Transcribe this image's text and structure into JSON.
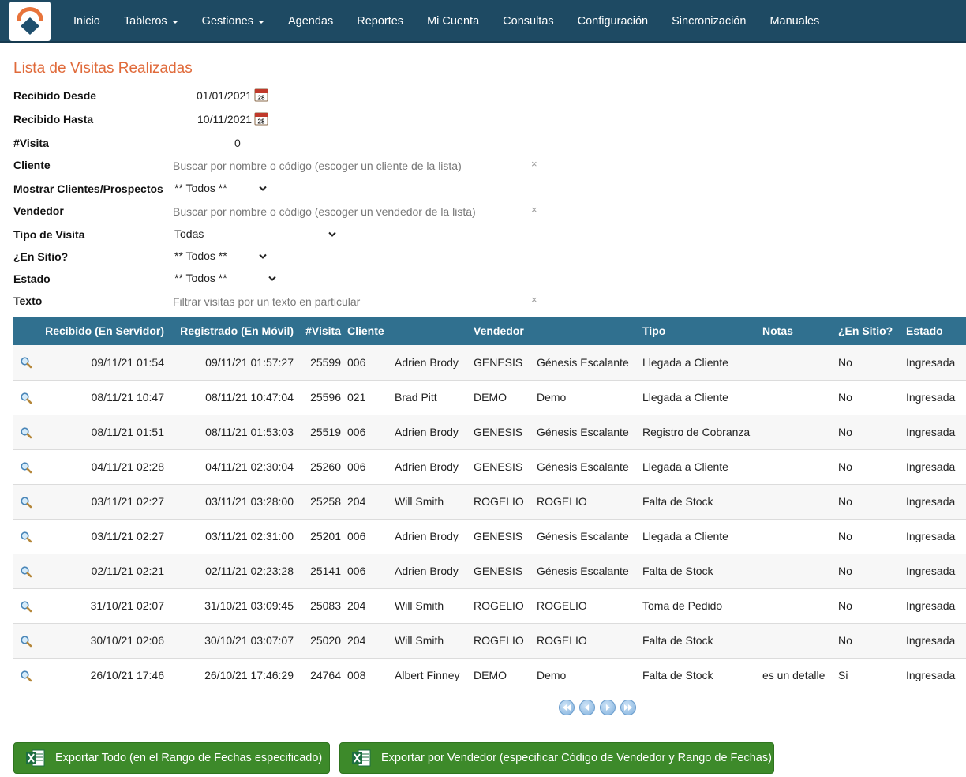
{
  "nav": {
    "items": [
      "Inicio",
      "Tableros",
      "Gestiones",
      "Agendas",
      "Reportes",
      "Mi Cuenta",
      "Consultas",
      "Configuración",
      "Sincronización",
      "Manuales"
    ]
  },
  "page": {
    "title": "Lista de Visitas Realizadas"
  },
  "filters": {
    "recibido_desde": {
      "label": "Recibido Desde",
      "value": "01/01/2021"
    },
    "recibido_hasta": {
      "label": "Recibido Hasta",
      "value": "10/11/2021"
    },
    "visita": {
      "label": "#Visita",
      "value": "0"
    },
    "cliente": {
      "label": "Cliente",
      "placeholder": "Buscar por nombre o código (escoger un cliente de la lista)"
    },
    "mostrar": {
      "label": "Mostrar Clientes/Prospectos",
      "value": "** Todos **"
    },
    "vendedor": {
      "label": "Vendedor",
      "placeholder": "Buscar por nombre o código (escoger un vendedor de la lista)"
    },
    "tipo": {
      "label": "Tipo de Visita",
      "value": "Todas"
    },
    "en_sitio": {
      "label": "¿En Sitio?",
      "value": "** Todos **"
    },
    "estado": {
      "label": "Estado",
      "value": "** Todos **"
    },
    "texto": {
      "label": "Texto",
      "placeholder": "Filtrar visitas por un texto en particular"
    },
    "clear_glyph": "×",
    "calendar_day": "28"
  },
  "table": {
    "headers": [
      "Recibido (En Servidor)",
      "Registrado (En Móvil)",
      "#Visita",
      "Cliente",
      "Vendedor",
      "Tipo",
      "Notas",
      "¿En Sitio?",
      "Estado"
    ],
    "rows": [
      [
        "09/11/21 01:54",
        "09/11/21 01:57:27",
        "25599",
        "006",
        "Adrien Brody",
        "GENESIS",
        "Génesis Escalante",
        "Llegada a Cliente",
        "",
        "No",
        "Ingresada"
      ],
      [
        "08/11/21 10:47",
        "08/11/21 10:47:04",
        "25596",
        "021",
        "Brad Pitt",
        "DEMO",
        "Demo",
        "Llegada a Cliente",
        "",
        "No",
        "Ingresada"
      ],
      [
        "08/11/21 01:51",
        "08/11/21 01:53:03",
        "25519",
        "006",
        "Adrien Brody",
        "GENESIS",
        "Génesis Escalante",
        "Registro de Cobranza",
        "",
        "No",
        "Ingresada"
      ],
      [
        "04/11/21 02:28",
        "04/11/21 02:30:04",
        "25260",
        "006",
        "Adrien Brody",
        "GENESIS",
        "Génesis Escalante",
        "Llegada a Cliente",
        "",
        "No",
        "Ingresada"
      ],
      [
        "03/11/21 02:27",
        "03/11/21 03:28:00",
        "25258",
        "204",
        "Will Smith",
        "ROGELIO",
        "ROGELIO",
        "Falta de Stock",
        "",
        "No",
        "Ingresada"
      ],
      [
        "03/11/21 02:27",
        "03/11/21 02:31:00",
        "25201",
        "006",
        "Adrien Brody",
        "GENESIS",
        "Génesis Escalante",
        "Llegada a Cliente",
        "",
        "No",
        "Ingresada"
      ],
      [
        "02/11/21 02:21",
        "02/11/21 02:23:28",
        "25141",
        "006",
        "Adrien Brody",
        "GENESIS",
        "Génesis Escalante",
        "Falta de Stock",
        "",
        "No",
        "Ingresada"
      ],
      [
        "31/10/21 02:07",
        "31/10/21 03:09:45",
        "25083",
        "204",
        "Will Smith",
        "ROGELIO",
        "ROGELIO",
        "Toma de Pedido",
        "",
        "No",
        "Ingresada"
      ],
      [
        "30/10/21 02:06",
        "30/10/21 03:07:07",
        "25020",
        "204",
        "Will Smith",
        "ROGELIO",
        "ROGELIO",
        "Falta de Stock",
        "",
        "No",
        "Ingresada"
      ],
      [
        "26/10/21 17:46",
        "26/10/21 17:46:29",
        "24764",
        "008",
        "Albert Finney",
        "DEMO",
        "Demo",
        "Falta de Stock",
        "es un detalle",
        "Si",
        "Ingresada"
      ]
    ]
  },
  "pager": {
    "icons": [
      "first-page-icon",
      "prev-page-icon",
      "next-page-icon",
      "last-page-icon"
    ]
  },
  "export": {
    "all_label": "Exportar Todo (en el Rango de Fechas especificado)",
    "vendor_label": "Exportar por Vendedor (especificar Código de Vendedor y Rango de Fechas)"
  },
  "colors": {
    "navbar": "#1e4a63",
    "title": "#e06a3a",
    "table_header": "#30708f",
    "export": "#3d8a2a"
  }
}
